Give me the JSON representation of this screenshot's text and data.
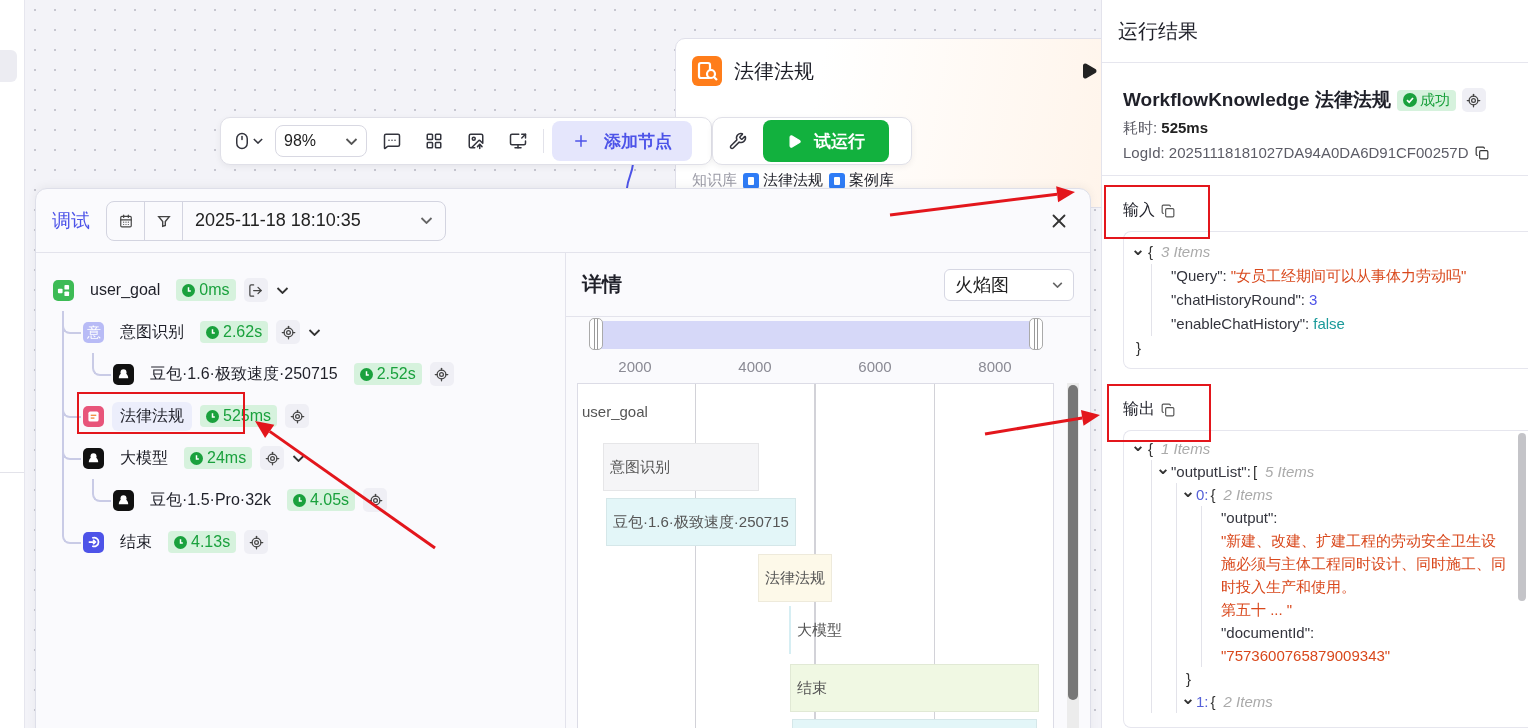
{
  "canvas": {
    "node": {
      "title": "法律法规",
      "knowledge_label": "知识库",
      "knowledge_bases": [
        "法律法规",
        "案例库"
      ]
    }
  },
  "toolbar": {
    "zoom": "98%",
    "add_node": "添加节点",
    "test_run": "试运行"
  },
  "debug_panel": {
    "title": "调试",
    "run_time": "2025-11-18 18:10:35",
    "trace": {
      "name": "user_goal",
      "kind": "start",
      "time": "0ms",
      "selected": false,
      "expanded": true,
      "children": [
        {
          "name": "意图识别",
          "kind": "intent",
          "icon_label": "意",
          "time": "2.62s",
          "selected": false,
          "expanded": true,
          "children": [
            {
              "name": "豆包·1.6·极致速度·250715",
              "kind": "llm",
              "time": "2.52s",
              "selected": false
            }
          ]
        },
        {
          "name": "法律法规",
          "kind": "knowledge",
          "time": "525ms",
          "selected": true
        },
        {
          "name": "大模型",
          "kind": "llm",
          "time": "24ms",
          "selected": false,
          "expanded": true,
          "children": [
            {
              "name": "豆包·1.5·Pro·32k",
              "kind": "llm",
              "time": "4.05s",
              "selected": false
            }
          ]
        },
        {
          "name": "结束",
          "kind": "end",
          "time": "4.13s",
          "selected": false
        }
      ]
    },
    "detail": {
      "title": "详情",
      "view": "火焰图",
      "range": {
        "level": 1
      },
      "axis_ticks": [
        "2000",
        "4000",
        "6000",
        "8000"
      ],
      "bars": [
        {
          "label": "user_goal"
        },
        {
          "label": "意图识别",
          "color": "#f5f5f7"
        },
        {
          "label": "豆包·1.6·极致速度·250715",
          "color": "#e3f6f8"
        },
        {
          "label": "法律法规",
          "color": "#fdf9e9"
        },
        {
          "label": "大模型",
          "color": "#d6eef3"
        },
        {
          "label": "结束",
          "color": "#f0f8e3"
        },
        {
          "color": "#e3f6f8"
        }
      ]
    }
  },
  "result": {
    "title": "运行结果",
    "node_title": "WorkflowKnowledge 法律法规",
    "status": "成功",
    "duration": "耗时: **525ms**",
    "log_id": "LogId: 20251118181027DA94A0DA6D91CF00257D",
    "input_label": "输入",
    "input": {
      "open": "{",
      "count": "3 Items",
      "expanded": true,
      "close": "}",
      "children": [
        {
          "key": "\"Query\":",
          "value": "\"女员工经期间可以从事体力劳动吗\"",
          "kind": "string"
        },
        {
          "key": "\"chatHistoryRound\":",
          "value": "3",
          "kind": "number"
        },
        {
          "key": "\"enableChatHistory\":",
          "value": "false",
          "kind": "boolean"
        }
      ]
    },
    "output_label": "输出",
    "output": {
      "open": "{",
      "count": "1 Items",
      "expanded": true,
      "children": [
        {
          "key": "\"outputList\":",
          "open": "[",
          "count": "5 Items",
          "expanded": true,
          "children": [
            {
              "key": "0:",
              "kind": "index",
              "open": "{",
              "count": "2 Items",
              "expanded": true,
              "close": "}",
              "children": [
                {
                  "key": "\"output\":",
                  "kind": "string",
                  "lines": [
                    "\"新建、改建、扩建工程的劳动安全卫生设施必须与主体工程同时设计、同时施工、同时投入生产和使用。",
                    "第五十 ... \""
                  ]
                },
                {
                  "key": "\"documentId\":",
                  "kind": "string",
                  "lines": [
                    "\"7573600765879009343\""
                  ]
                }
              ]
            },
            {
              "key": "1:",
              "kind": "index",
              "open": "{",
              "count": "2 Items",
              "expanded": true
            }
          ]
        }
      ]
    }
  }
}
